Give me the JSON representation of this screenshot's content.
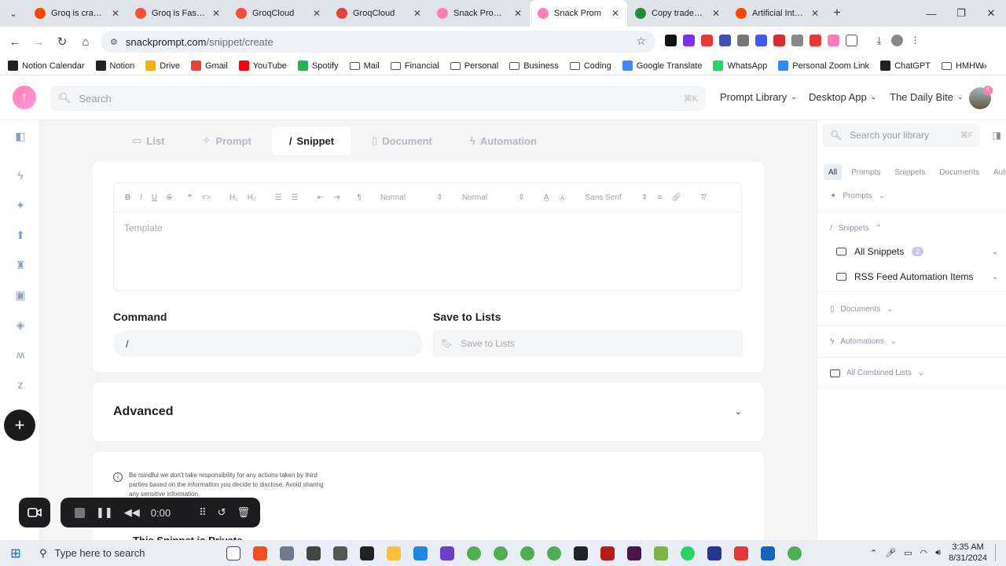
{
  "browser": {
    "tabs": [
      {
        "title": "Groq is crazy fa",
        "color": "#ff4500"
      },
      {
        "title": "Groq is Fast AI",
        "color": "#f55036"
      },
      {
        "title": "GroqCloud",
        "color": "#f55036"
      },
      {
        "title": "GroqCloud",
        "color": "#e0443a"
      },
      {
        "title": "Snack Prompt |",
        "color": "#ff7eb9"
      },
      {
        "title": "Snack Prom",
        "color": "#ff7eb9",
        "active": true
      },
      {
        "title": "Copy trades of",
        "color": "#1e8e3e"
      },
      {
        "title": "Artificial Intellig",
        "color": "#ff4500"
      }
    ],
    "url_host": "snackprompt.com",
    "url_path": "/snippet/create",
    "bookmarks": [
      {
        "label": "Notion Calendar",
        "icon": "calendar-icon",
        "color": "#222"
      },
      {
        "label": "Notion",
        "icon": "notion-icon",
        "color": "#222"
      },
      {
        "label": "Drive",
        "icon": "drive-icon",
        "color": "#f4b400"
      },
      {
        "label": "Gmail",
        "icon": "gmail-icon",
        "color": "#ea4335"
      },
      {
        "label": "YouTube",
        "icon": "youtube-icon",
        "color": "#ff0000"
      },
      {
        "label": "Spotify",
        "icon": "spotify-icon",
        "color": "#1db954"
      },
      {
        "label": "Mail",
        "icon": "folder-icon",
        "color": ""
      },
      {
        "label": "Financial",
        "icon": "folder-icon",
        "color": ""
      },
      {
        "label": "Personal",
        "icon": "folder-icon",
        "color": ""
      },
      {
        "label": "Business",
        "icon": "folder-icon",
        "color": ""
      },
      {
        "label": "Coding",
        "icon": "folder-icon",
        "color": ""
      },
      {
        "label": "Google Translate",
        "icon": "translate-icon",
        "color": "#4285f4"
      },
      {
        "label": "WhatsApp",
        "icon": "whatsapp-icon",
        "color": "#25d366"
      },
      {
        "label": "Personal Zoom Link",
        "icon": "zoom-icon",
        "color": "#2d8cff"
      },
      {
        "label": "ChatGPT",
        "icon": "chatgpt-icon",
        "color": "#222"
      },
      {
        "label": "HMHW",
        "icon": "folder-icon",
        "color": ""
      }
    ]
  },
  "header": {
    "search_placeholder": "Search",
    "search_shortcut": "⌘K",
    "nav": [
      "Prompt Library",
      "Desktop App",
      "The Daily Bite"
    ]
  },
  "editor": {
    "type_tabs": [
      {
        "label": "List",
        "icon": "folder-icon"
      },
      {
        "label": "Prompt",
        "icon": "sparkle-icon"
      },
      {
        "label": "Snippet",
        "icon": "slash-icon",
        "active": true
      },
      {
        "label": "Document",
        "icon": "document-icon"
      },
      {
        "label": "Automation",
        "icon": "bolt-icon"
      }
    ],
    "toolbar": {
      "size1": "Normal",
      "size2": "Normal",
      "font": "Sans Serif"
    },
    "template_placeholder": "Template",
    "command_label": "Command",
    "command_value": "/",
    "lists_label": "Save to Lists",
    "lists_placeholder": "Save to Lists",
    "advanced_label": "Advanced",
    "disclaimer": "Be mindful we don't take responsibility for any actions taken by third parties based on the information you decide to disclose. Avoid sharing any sensitive information.",
    "private_label": "This Snippet is Private"
  },
  "library": {
    "search_placeholder": "Search your library",
    "search_shortcut": "⌘F",
    "filters": [
      "All",
      "Prompts",
      "Snippets",
      "Documents",
      "Auto"
    ],
    "sections": {
      "prompts": "Prompts",
      "snippets": "Snippets",
      "documents": "Documents",
      "automations": "Automations",
      "combined": "All Combined Lists"
    },
    "snippet_lists": [
      {
        "label": "All Snippets",
        "count": "2"
      },
      {
        "label": "RSS Feed Automation Items",
        "count": ""
      }
    ]
  },
  "recorder": {
    "time": "0:00"
  },
  "taskbar": {
    "search_placeholder": "Type here to search",
    "time": "3:35 AM",
    "date": "8/31/2024"
  }
}
